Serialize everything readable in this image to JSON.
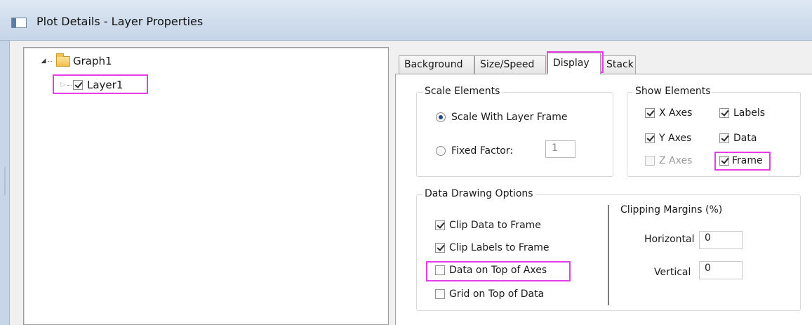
{
  "window": {
    "title": "Plot Details - Layer Properties"
  },
  "tree": {
    "root": {
      "label": "Graph1",
      "expanded": true,
      "icon": "folder-icon"
    },
    "child": {
      "label": "Layer1",
      "checked": true
    }
  },
  "tabs": [
    {
      "label": "Background",
      "active": false
    },
    {
      "label": "Size/Speed",
      "active": false
    },
    {
      "label": "Display",
      "active": true
    },
    {
      "label": "Stack",
      "active": false
    }
  ],
  "scale_elements": {
    "title": "Scale Elements",
    "scale_with_layer_frame": "Scale With Layer Frame",
    "fixed_factor_label": "Fixed Factor:",
    "fixed_factor_value": "1",
    "selected": "scale_with_layer_frame"
  },
  "show_elements": {
    "title": "Show Elements",
    "x_axes": "X Axes",
    "y_axes": "Y Axes",
    "z_axes": "Z Axes",
    "labels": "Labels",
    "data": "Data",
    "frame": "Frame"
  },
  "data_drawing": {
    "title": "Data Drawing Options",
    "clip_data": "Clip Data to Frame",
    "clip_labels": "Clip Labels to Frame",
    "data_on_top": "Data on Top of Axes",
    "grid_on_top": "Grid on Top of Data"
  },
  "clipping_margins": {
    "title": "Clipping Margins (%)",
    "horizontal_label": "Horizontal",
    "horizontal_value": "0",
    "vertical_label": "Vertical",
    "vertical_value": "0"
  },
  "colors": {
    "highlight": "#e63ee6",
    "title_bar": "#cfdcec"
  }
}
